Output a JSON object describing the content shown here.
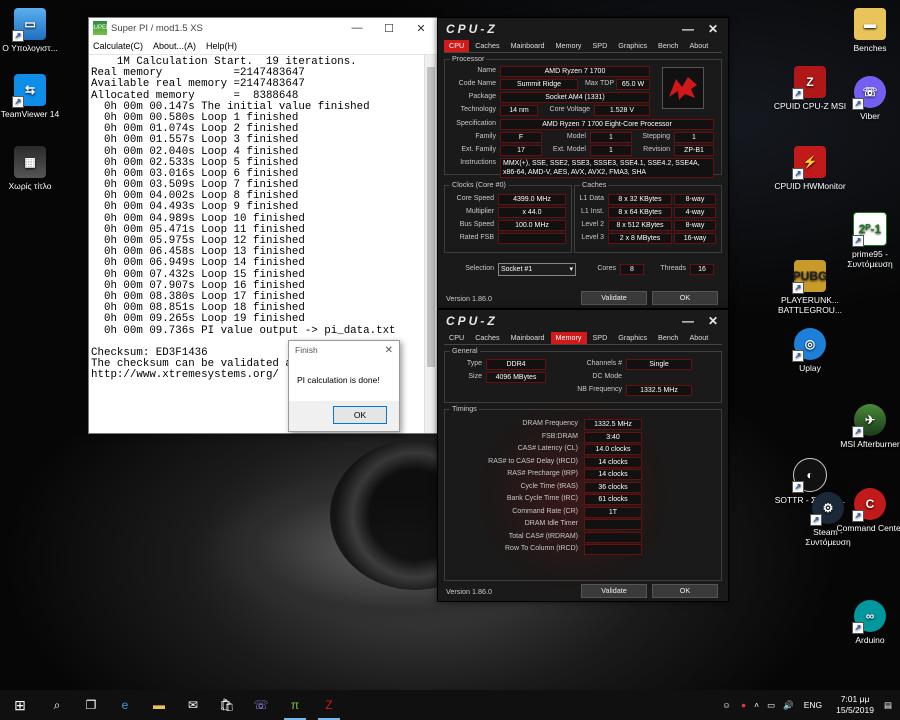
{
  "desktop": {
    "icons_left": [
      {
        "label": "Ο Υπολογιστ...",
        "icon": "computer-icon"
      },
      {
        "label": "TeamViewer 14",
        "icon": "teamviewer-icon"
      },
      {
        "label": "Χωρίς τίτλο",
        "icon": "image-file-icon"
      }
    ],
    "icons_right": [
      {
        "label": "Benches",
        "icon": "folder-icon"
      },
      {
        "label": "CPUID CPU-Z MSI",
        "icon": "cpuz-icon"
      },
      {
        "label": "Viber",
        "icon": "viber-icon"
      },
      {
        "label": "CPUID HWMonitor",
        "icon": "hwmonitor-icon"
      },
      {
        "label": "prime95 - Συντόμευση",
        "icon": "prime95-icon"
      },
      {
        "label": "PLAYERUNK... BATTLEGROU...",
        "icon": "pubg-icon"
      },
      {
        "label": "Uplay",
        "icon": "uplay-icon"
      },
      {
        "label": "MSI Afterburner",
        "icon": "afterburner-icon"
      },
      {
        "label": "SOTTR - Συντόμ...",
        "icon": "sottr-icon"
      },
      {
        "label": "Steam - Συντόμευση",
        "icon": "steam-icon"
      },
      {
        "label": "Command Center",
        "icon": "command-center-icon"
      },
      {
        "label": "Arduino",
        "icon": "arduino-icon"
      }
    ]
  },
  "superpi": {
    "title": "Super PI / mod1.5 XS",
    "logo": "SUPER",
    "menu": [
      "Calculate(C)",
      "About...(A)",
      "Help(H)"
    ],
    "output_lines": [
      "    1M Calculation Start.  19 iterations.",
      "Real memory           =2147483647",
      "Available real memory =2147483647",
      "Allocated memory      =  8388648",
      "  0h 00m 00.147s The initial value finished",
      "  0h 00m 00.580s Loop 1 finished",
      "  0h 00m 01.074s Loop 2 finished",
      "  0h 00m 01.557s Loop 3 finished",
      "  0h 00m 02.040s Loop 4 finished",
      "  0h 00m 02.533s Loop 5 finished",
      "  0h 00m 03.016s Loop 6 finished",
      "  0h 00m 03.509s Loop 7 finished",
      "  0h 00m 04.002s Loop 8 finished",
      "  0h 00m 04.493s Loop 9 finished",
      "  0h 00m 04.989s Loop 10 finished",
      "  0h 00m 05.471s Loop 11 finished",
      "  0h 00m 05.975s Loop 12 finished",
      "  0h 00m 06.458s Loop 13 finished",
      "  0h 00m 06.949s Loop 14 finished",
      "  0h 00m 07.432s Loop 15 finished",
      "  0h 00m 07.907s Loop 16 finished",
      "  0h 00m 08.380s Loop 17 finished",
      "  0h 00m 08.851s Loop 18 finished",
      "  0h 00m 09.265s Loop 19 finished",
      "  0h 00m 09.736s PI value output -> pi_data.txt",
      "",
      "Checksum: ED3F1436",
      "The checksum can be validated at",
      "http://www.xtremesystems.org/"
    ]
  },
  "finish_dialog": {
    "title": "Finish",
    "message": "PI calculation is done!",
    "ok": "OK"
  },
  "cpuz_cpu": {
    "title": "CPU-Z",
    "tabs": [
      "CPU",
      "Caches",
      "Mainboard",
      "Memory",
      "SPD",
      "Graphics",
      "Bench",
      "About"
    ],
    "active_tab": "CPU",
    "processor_group": "Processor",
    "name_label": "Name",
    "name": "AMD Ryzen 7 1700",
    "codename_label": "Code Name",
    "codename": "Summit Ridge",
    "maxtdp_label": "Max TDP",
    "maxtdp": "65.0 W",
    "package_label": "Package",
    "package": "Socket AM4 (1331)",
    "technology_label": "Technology",
    "technology": "14 nm",
    "corevoltage_label": "Core Voltage",
    "corevoltage": "1.528 V",
    "spec_label": "Specification",
    "spec": "AMD Ryzen 7 1700 Eight-Core Processor",
    "family_label": "Family",
    "family": "F",
    "model_label": "Model",
    "model": "1",
    "stepping_label": "Stepping",
    "stepping": "1",
    "extfamily_label": "Ext. Family",
    "extfamily": "17",
    "extmodel_label": "Ext. Model",
    "extmodel": "1",
    "revision_label": "Revision",
    "revision": "ZP-B1",
    "instructions_label": "Instructions",
    "instructions": "MMX(+), SSE, SSE2, SSE3, SSSE3, SSE4.1, SSE4.2, SSE4A, x86-64, AMD-V, AES, AVX, AVX2, FMA3, SHA",
    "clocks_group": "Clocks (Core #0)",
    "corespeed_label": "Core Speed",
    "corespeed": "4399.0 MHz",
    "multiplier_label": "Multiplier",
    "multiplier": "x 44.0",
    "busspeed_label": "Bus Speed",
    "busspeed": "100.0 MHz",
    "ratedfsb_label": "Rated FSB",
    "ratedfsb": "",
    "caches_group": "Caches",
    "l1d_label": "L1 Data",
    "l1d": "8 x 32 KBytes",
    "l1d_way": "8-way",
    "l1i_label": "L1 Inst.",
    "l1i": "8 x 64 KBytes",
    "l1i_way": "4-way",
    "l2_label": "Level 2",
    "l2": "8 x 512 KBytes",
    "l2_way": "8-way",
    "l3_label": "Level 3",
    "l3": "2 x 8 MBytes",
    "l3_way": "16-way",
    "selection_label": "Selection",
    "selection": "Socket #1",
    "cores_label": "Cores",
    "cores": "8",
    "threads_label": "Threads",
    "threads": "16",
    "version": "Version 1.86.0",
    "validate": "Validate",
    "ok": "OK"
  },
  "cpuz_mem": {
    "title": "CPU-Z",
    "tabs": [
      "CPU",
      "Caches",
      "Mainboard",
      "Memory",
      "SPD",
      "Graphics",
      "Bench",
      "About"
    ],
    "active_tab": "Memory",
    "general_group": "General",
    "type_label": "Type",
    "type": "DDR4",
    "size_label": "Size",
    "size": "4096 MBytes",
    "channels_label": "Channels #",
    "channels": "Single",
    "dcmode_label": "DC Mode",
    "dcmode": "",
    "nbfreq_label": "NB Frequency",
    "nbfreq": "1332.5 MHz",
    "timings_group": "Timings",
    "timings": [
      {
        "label": "DRAM Frequency",
        "value": "1332.5 MHz"
      },
      {
        "label": "FSB:DRAM",
        "value": "3:40"
      },
      {
        "label": "CAS# Latency (CL)",
        "value": "14.0 clocks"
      },
      {
        "label": "RAS# to CAS# Delay (tRCD)",
        "value": "14 clocks"
      },
      {
        "label": "RAS# Precharge (tRP)",
        "value": "14 clocks"
      },
      {
        "label": "Cycle Time (tRAS)",
        "value": "36 clocks"
      },
      {
        "label": "Bank Cycle Time (tRC)",
        "value": "61 clocks"
      },
      {
        "label": "Command Rate (CR)",
        "value": "1T"
      },
      {
        "label": "DRAM Idle Timer",
        "value": ""
      },
      {
        "label": "Total CAS# (tRDRAM)",
        "value": ""
      },
      {
        "label": "Row To Column (tRCD)",
        "value": ""
      }
    ],
    "version": "Version 1.86.0",
    "validate": "Validate",
    "ok": "OK"
  },
  "taskbar": {
    "lang": "ENG",
    "time": "7:01 μμ",
    "date": "15/5/2019"
  }
}
